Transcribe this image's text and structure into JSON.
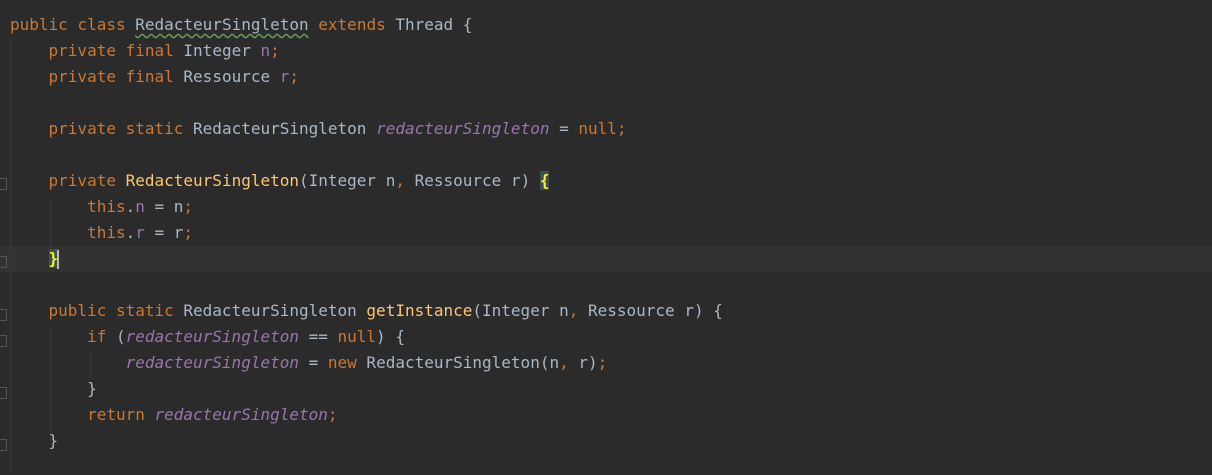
{
  "editor": {
    "language": "java",
    "lines": [
      [
        {
          "t": "public",
          "s": "kw"
        },
        {
          "t": " "
        },
        {
          "t": "class",
          "s": "kw"
        },
        {
          "t": " "
        },
        {
          "t": "RedacteurSingleton",
          "s": "typo"
        },
        {
          "t": " "
        },
        {
          "t": "extends",
          "s": "kw"
        },
        {
          "t": " Thread {"
        }
      ],
      [
        {
          "t": "    "
        },
        {
          "t": "private",
          "s": "kw"
        },
        {
          "t": " "
        },
        {
          "t": "final",
          "s": "kw"
        },
        {
          "t": " Integer "
        },
        {
          "t": "n",
          "s": "fld"
        },
        {
          "t": ";",
          "s": "kw"
        }
      ],
      [
        {
          "t": "    "
        },
        {
          "t": "private",
          "s": "kw"
        },
        {
          "t": " "
        },
        {
          "t": "final",
          "s": "kw"
        },
        {
          "t": " Ressource "
        },
        {
          "t": "r",
          "s": "fld"
        },
        {
          "t": ";",
          "s": "kw"
        }
      ],
      [],
      [
        {
          "t": "    "
        },
        {
          "t": "private",
          "s": "kw"
        },
        {
          "t": " "
        },
        {
          "t": "static",
          "s": "kw"
        },
        {
          "t": " RedacteurSingleton "
        },
        {
          "t": "redacteurSingleton",
          "s": "sfld"
        },
        {
          "t": " = "
        },
        {
          "t": "null",
          "s": "kw"
        },
        {
          "t": ";",
          "s": "kw"
        }
      ],
      [],
      [
        {
          "t": "    "
        },
        {
          "t": "private",
          "s": "kw"
        },
        {
          "t": " "
        },
        {
          "t": "RedacteurSingleton",
          "s": "fn"
        },
        {
          "t": "(Integer n"
        },
        {
          "t": ",",
          "s": "kw"
        },
        {
          "t": " Ressource r) "
        },
        {
          "t": "{",
          "s": "brace-hl"
        }
      ],
      [
        {
          "t": "        "
        },
        {
          "t": "this",
          "s": "kw"
        },
        {
          "t": "."
        },
        {
          "t": "n",
          "s": "fld"
        },
        {
          "t": " = n"
        },
        {
          "t": ";",
          "s": "kw"
        }
      ],
      [
        {
          "t": "        "
        },
        {
          "t": "this",
          "s": "kw"
        },
        {
          "t": "."
        },
        {
          "t": "r",
          "s": "fld"
        },
        {
          "t": " = r"
        },
        {
          "t": ";",
          "s": "kw"
        }
      ],
      [
        {
          "t": "    "
        },
        {
          "t": "}",
          "s": "brace-hl"
        },
        {
          "t": "",
          "s": "caret"
        }
      ],
      [],
      [
        {
          "t": "    "
        },
        {
          "t": "public",
          "s": "kw"
        },
        {
          "t": " "
        },
        {
          "t": "static",
          "s": "kw"
        },
        {
          "t": " RedacteurSingleton "
        },
        {
          "t": "getInstance",
          "s": "fn"
        },
        {
          "t": "(Integer n"
        },
        {
          "t": ",",
          "s": "kw"
        },
        {
          "t": " Ressource r) {"
        }
      ],
      [
        {
          "t": "        "
        },
        {
          "t": "if",
          "s": "kw"
        },
        {
          "t": " ("
        },
        {
          "t": "redacteurSingleton",
          "s": "sfld"
        },
        {
          "t": " == "
        },
        {
          "t": "null",
          "s": "kw"
        },
        {
          "t": ") {"
        }
      ],
      [
        {
          "t": "            "
        },
        {
          "t": "redacteurSingleton",
          "s": "sfld"
        },
        {
          "t": " = "
        },
        {
          "t": "new",
          "s": "kw"
        },
        {
          "t": " RedacteurSingleton(n"
        },
        {
          "t": ",",
          "s": "kw"
        },
        {
          "t": " r)"
        },
        {
          "t": ";",
          "s": "kw"
        }
      ],
      [
        {
          "t": "        }"
        }
      ],
      [
        {
          "t": "        "
        },
        {
          "t": "return",
          "s": "kw"
        },
        {
          "t": " "
        },
        {
          "t": "redacteurSingleton",
          "s": "sfld"
        },
        {
          "t": ";",
          "s": "kw"
        }
      ],
      [
        {
          "t": "    }"
        }
      ],
      []
    ]
  },
  "colors": {
    "background": "#2b2b2b",
    "current_line": "#323232",
    "default_text": "#a9b7c6",
    "keyword": "#cc7832",
    "field": "#9876aa",
    "method_declaration": "#ffc66d",
    "brace_match_bg": "#3b514d",
    "brace_match_fg": "#ffef28"
  }
}
